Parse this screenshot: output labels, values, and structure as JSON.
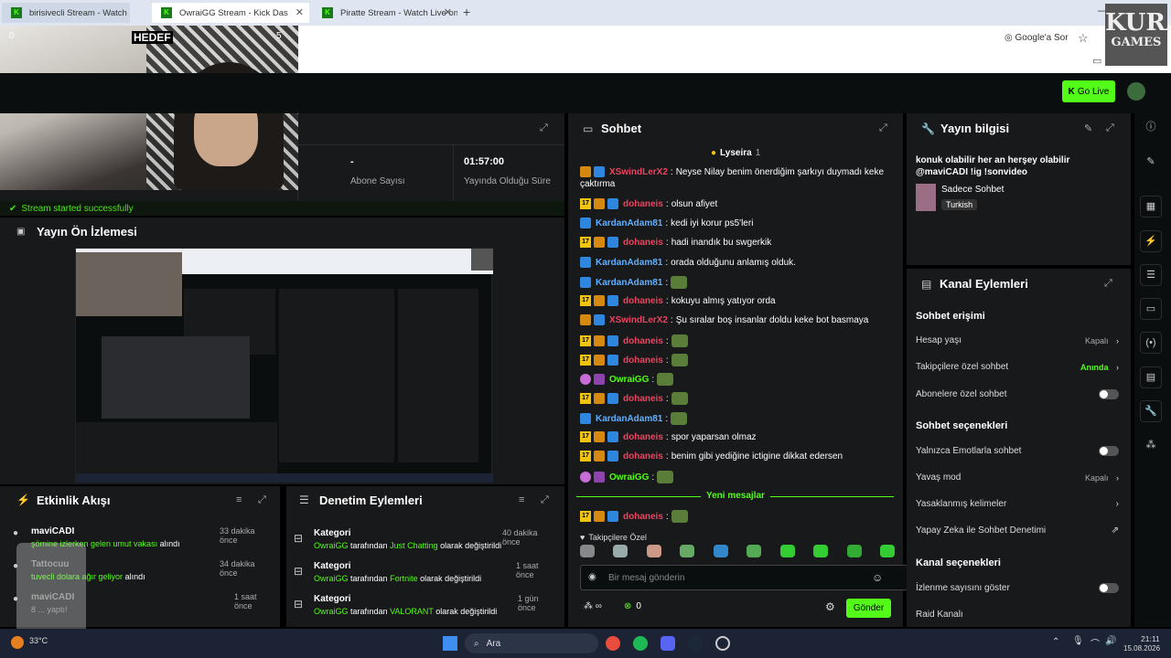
{
  "browser": {
    "tabs": [
      {
        "label": "birisivecli Stream - Watch L",
        "badge": "0"
      },
      {
        "label": "OwraiGG Stream - Kick Das",
        "overlay": "HEDEF",
        "badge": "5"
      },
      {
        "label": "Piratte Stream - Watch Live on"
      }
    ],
    "new_tab": "+",
    "google_ask": "Google'a Sor",
    "watermark_top": "KURA",
    "watermark_bottom": "GAMES"
  },
  "topnav": {
    "go_live": "Go Live"
  },
  "stats": {
    "sub_value": "-",
    "sub_label": "Abone Sayısı",
    "time_value": "01:57:00",
    "time_label": "Yayında Olduğu Süre",
    "toast": "Stream started successfully"
  },
  "preview": {
    "title": "Yayın Ön İzlemesi"
  },
  "activity": {
    "title": "Etkinlik Akışı",
    "items": [
      {
        "user": "maviCADI",
        "text": "şömine izlerken gelen umut vakası",
        "suffix": "alındı",
        "time": "33 dakika önce"
      },
      {
        "user": "Tattocuu",
        "text": "tuvecli dolara ağır geliyor",
        "suffix": "alındı",
        "time": "34 dakika önce"
      },
      {
        "user": "maviCADI",
        "text": "8 ... yaptı!",
        "suffix": "",
        "time": "1 saat önce"
      }
    ]
  },
  "moderation": {
    "title": "Denetim Eylemleri",
    "items": [
      {
        "title": "Kategori",
        "user": "OwraiGG",
        "mid": "tarafından",
        "value": "Just Chatting",
        "end": "olarak değiştirildi",
        "time": "40 dakika önce"
      },
      {
        "title": "Kategori",
        "user": "OwraiGG",
        "mid": "tarafından",
        "value": "Fortnite",
        "end": "olarak değiştirildi",
        "time": "1 saat önce"
      },
      {
        "title": "Kategori",
        "user": "OwraiGG",
        "mid": "tarafından",
        "value": "VALORANT",
        "end": "olarak değiştirildi",
        "time": "1 gün önce"
      }
    ]
  },
  "chat": {
    "title": "Sohbet",
    "pinned": "Lyseira",
    "pinned_count": "1",
    "messages": [
      {
        "user": "XSwindLerX2",
        "color": "red",
        "text": "Neyse Nilay benim önerdiğim şarkıyı duymadı keke",
        "text2": "çaktırma",
        "badges": [
          "crown",
          "sparkle"
        ]
      },
      {
        "user": "dohaneis",
        "color": "red",
        "text": "olsun afiyet",
        "badges": [
          "17",
          "crown",
          "sparkle"
        ]
      },
      {
        "user": "KardanAdam81",
        "color": "blue",
        "text": "kedi iyi korur ps5'leri",
        "badges": [
          "sparkle"
        ]
      },
      {
        "user": "dohaneis",
        "color": "red",
        "text": "hadi inandık bu swgerkik",
        "badges": [
          "17",
          "crown",
          "sparkle"
        ]
      },
      {
        "user": "KardanAdam81",
        "color": "blue",
        "text": "orada olduğunu anlamış olduk.",
        "badges": [
          "sparkle"
        ]
      },
      {
        "user": "KardanAdam81",
        "color": "blue",
        "text": "",
        "badges": [
          "sparkle"
        ],
        "emote": true
      },
      {
        "user": "dohaneis",
        "color": "red",
        "text": "kokuyu almış yatıyor orda",
        "badges": [
          "17",
          "crown",
          "sparkle"
        ]
      },
      {
        "user": "XSwindLerX2",
        "color": "red",
        "text": "Şu sıralar boş insanlar doldu keke bot basmaya",
        "badges": [
          "crown",
          "sparkle"
        ]
      },
      {
        "user": "dohaneis",
        "color": "red",
        "text": "",
        "badges": [
          "17",
          "crown",
          "sparkle"
        ],
        "emote": true
      },
      {
        "user": "dohaneis",
        "color": "red",
        "text": "",
        "badges": [
          "17",
          "crown",
          "sparkle"
        ],
        "emote": true
      },
      {
        "user": "OwraiGG",
        "color": "green",
        "text": "",
        "badges": [
          "broadcaster",
          "mic"
        ],
        "emote": true
      },
      {
        "user": "dohaneis",
        "color": "red",
        "text": "",
        "badges": [
          "17",
          "crown",
          "sparkle"
        ],
        "emote": true
      },
      {
        "user": "KardanAdam81",
        "color": "blue",
        "text": "",
        "badges": [
          "sparkle"
        ],
        "emote": true
      },
      {
        "user": "dohaneis",
        "color": "red",
        "text": "spor yaparsan olmaz",
        "badges": [
          "17",
          "crown",
          "sparkle"
        ]
      },
      {
        "user": "dohaneis",
        "color": "red",
        "text": "benim gibi yediğine ictigine dikkat edersen",
        "badges": [
          "17",
          "crown",
          "sparkle"
        ]
      },
      {
        "user": "OwraiGG",
        "color": "green",
        "text": "",
        "badges": [
          "broadcaster",
          "mic"
        ],
        "emote": true
      }
    ],
    "new_messages": "Yeni mesajlar",
    "after_divider": {
      "user": "dohaneis",
      "color": "red",
      "text": "",
      "badges": [
        "17",
        "crown",
        "sparkle"
      ],
      "emote": true
    },
    "followers_only": "Takipçilere Özel",
    "input_placeholder": "Bir mesaj gönderin",
    "points": "0",
    "send": "Gönder"
  },
  "stream_info": {
    "title": "Yayın bilgisi",
    "description": "konuk olabilir her an herşey olabilir @maviCADI !ig !sonvideo",
    "category": "Sadece Sohbet",
    "language": "Turkish"
  },
  "channel_actions": {
    "title": "Kanal Eylemleri",
    "chat_access": "Sohbet erişimi",
    "account_age": "Hesap yaşı",
    "account_age_val": "Kapalı",
    "followers_chat": "Takipçilere özel sohbet",
    "followers_chat_val": "Anında",
    "subs_chat": "Abonelere özel sohbet",
    "chat_options": "Sohbet seçenekleri",
    "emotes_only": "Yalnızca Emotlarla sohbet",
    "slow_mode": "Yavaş mod",
    "slow_mode_val": "Kapalı",
    "banned_words": "Yasaklanmış kelimeler",
    "ai_mod": "Yapay Zeka ile Sohbet Denetimi",
    "channel_options": "Kanal seçenekleri",
    "show_viewers": "İzlenme sayısını göster",
    "raid": "Raid Kanalı"
  },
  "taskbar": {
    "search": "Ara",
    "time": "21:11",
    "date": "15.08.2026",
    "weather": "33°C"
  },
  "colors": {
    "accent": "#53fc18",
    "panel": "#18191b",
    "bg": "#0b0e0f"
  }
}
